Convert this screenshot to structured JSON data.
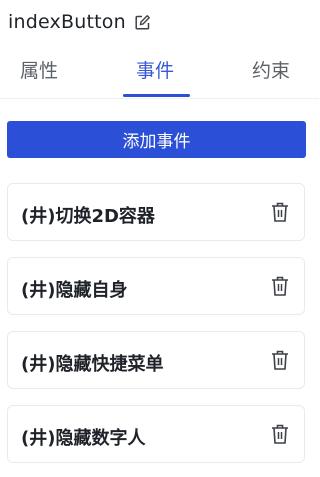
{
  "header": {
    "title": "indexButton",
    "edit_icon": "edit-icon"
  },
  "tabs": [
    {
      "label": "属性",
      "active": false
    },
    {
      "label": "事件",
      "active": true
    },
    {
      "label": "约束",
      "active": false
    }
  ],
  "actions": {
    "add_event_label": "添加事件"
  },
  "events": [
    {
      "label": "(井)切换2D容器",
      "icon": "trash-icon"
    },
    {
      "label": "(井)隐藏自身",
      "icon": "trash-icon"
    },
    {
      "label": "(井)隐藏快捷菜单",
      "icon": "trash-icon"
    },
    {
      "label": "(井)隐藏数字人",
      "icon": "trash-icon"
    }
  ],
  "colors": {
    "accent": "#2b4fd6",
    "text": "#1f2329",
    "tab_inactive": "#5d6168"
  }
}
